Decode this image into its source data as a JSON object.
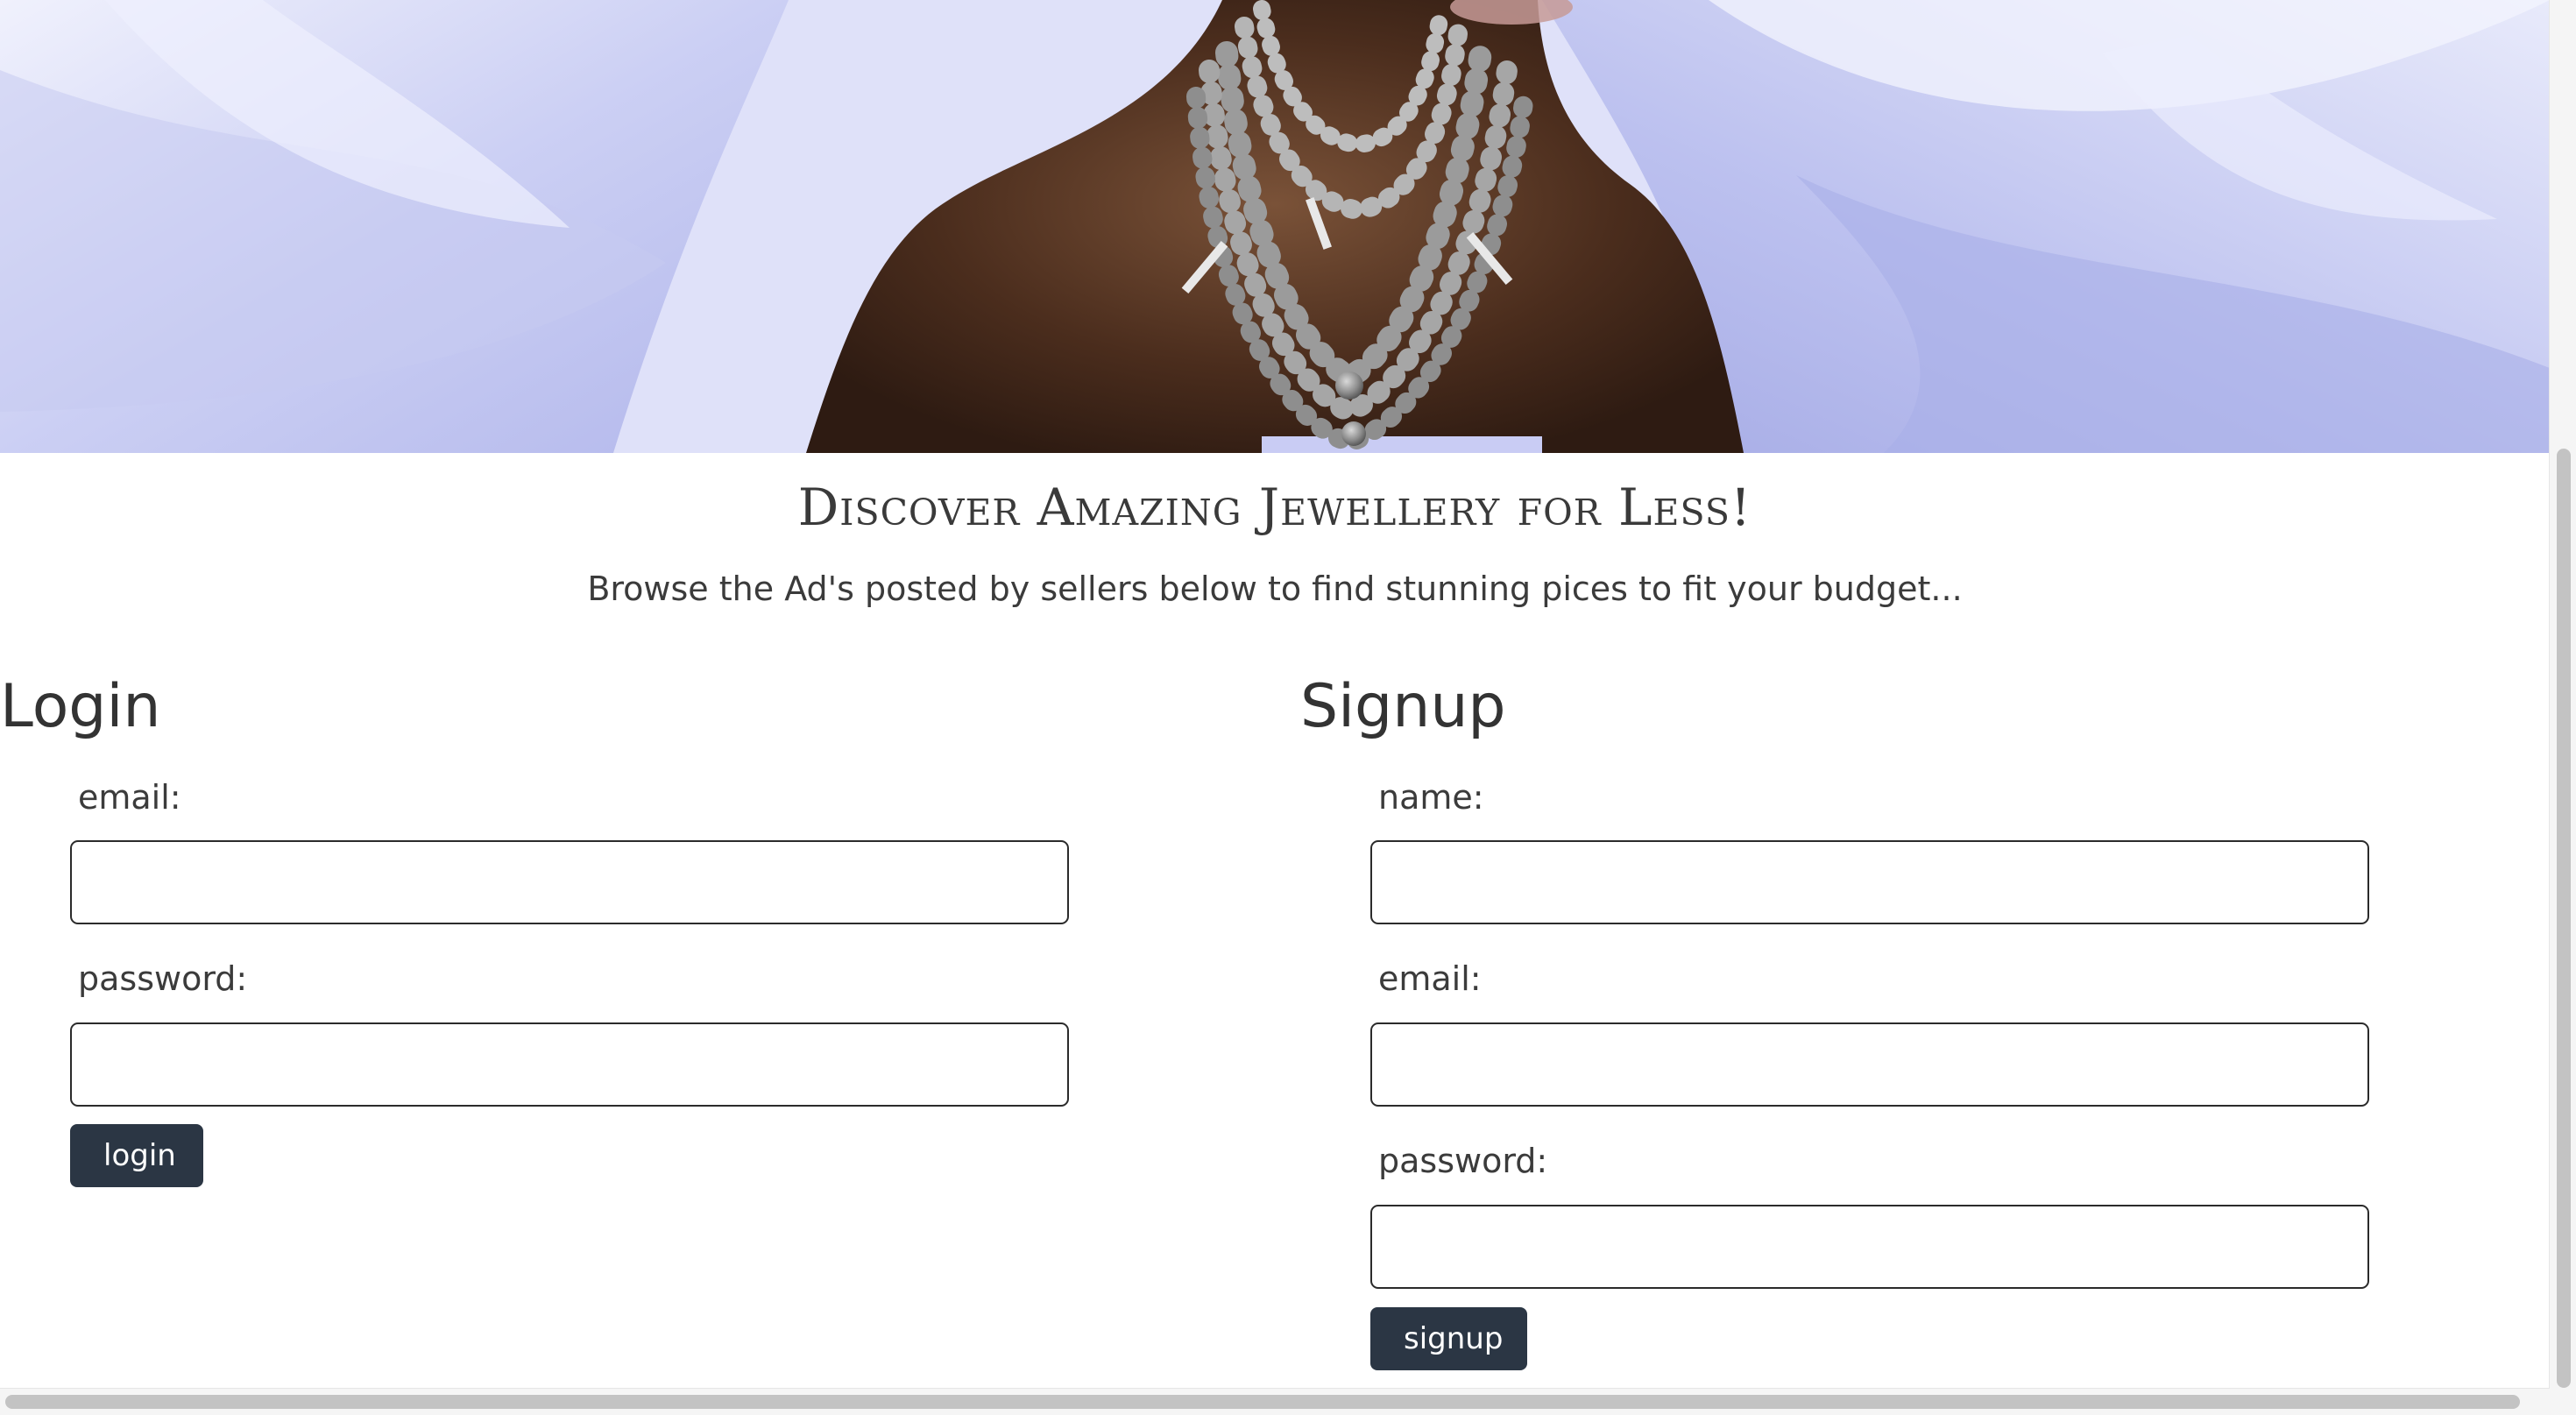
{
  "hero": {
    "image": "jewellery-model-necklace-banner"
  },
  "intro": {
    "headline": "Discover Amazing Jewellery for Less!",
    "subline": "Browse the Ad's posted by sellers below to find stunning pices to fit your budget..."
  },
  "login": {
    "title": "Login",
    "email_label": "email:",
    "email_value": "",
    "password_label": "password:",
    "password_value": "",
    "button_label": "login"
  },
  "signup": {
    "title": "Signup",
    "name_label": "name:",
    "name_value": "",
    "email_label": "email:",
    "email_value": "",
    "password_label": "password:",
    "password_value": "",
    "button_label": "signup"
  },
  "colors": {
    "button_bg": "#2b3644",
    "button_text": "#ffffff",
    "heading_text": "#3a3a3a",
    "hero_fabric": "#cfd2f5"
  }
}
